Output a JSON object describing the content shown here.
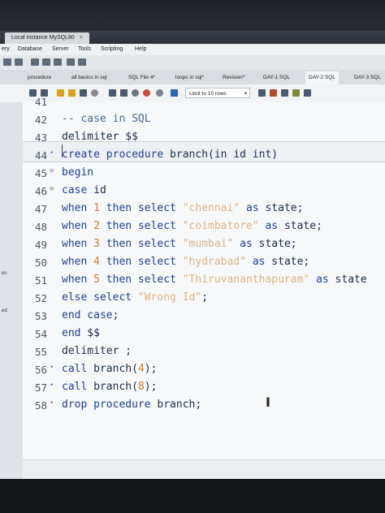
{
  "window": {
    "tab_title": "Local instance MySQL80",
    "tab_close": "×"
  },
  "menu": [
    "ery",
    "Database",
    "Server",
    "Tools",
    "Scripting",
    "Help"
  ],
  "file_tabs": [
    "procedure",
    "all basics in sql",
    "SQL File 4*",
    "loops in sql*",
    "Revision*",
    "DAY-1 SQL",
    "DAY-2 SQL",
    "DAY-3 SQL"
  ],
  "editor_toolbar": {
    "limit_label": "Limit to 10 rows",
    "limit_arrow": "▾"
  },
  "left_strip": [
    "es",
    "ed"
  ],
  "editor": {
    "lines": [
      {
        "num": "41",
        "fold": "",
        "tokens": []
      },
      {
        "num": "42",
        "fold": "",
        "tokens": [
          {
            "t": "cmt",
            "v": "-- case in SQL"
          }
        ]
      },
      {
        "num": "43",
        "fold": "",
        "tokens": [
          {
            "t": "txt",
            "v": "delimiter $$"
          }
        ]
      },
      {
        "num": "44",
        "fold": "•",
        "tokens": [
          {
            "t": "kw",
            "v": "create procedure"
          },
          {
            "t": "txt",
            "v": " branch(in id int)"
          }
        ]
      },
      {
        "num": "45",
        "fold": "⊖",
        "tokens": [
          {
            "t": "kw",
            "v": "begin"
          }
        ]
      },
      {
        "num": "46",
        "fold": "⊖",
        "tokens": [
          {
            "t": "kw",
            "v": "case"
          },
          {
            "t": "txt",
            "v": " id"
          }
        ]
      },
      {
        "num": "47",
        "fold": "",
        "tokens": [
          {
            "t": "kw",
            "v": "when"
          },
          {
            "t": "num",
            "v": " 1 "
          },
          {
            "t": "kw",
            "v": "then select"
          },
          {
            "t": "str",
            "v": " \"chennai\" "
          },
          {
            "t": "kw",
            "v": "as"
          },
          {
            "t": "txt",
            "v": " state;"
          }
        ]
      },
      {
        "num": "48",
        "fold": "",
        "tokens": [
          {
            "t": "kw",
            "v": "when"
          },
          {
            "t": "num",
            "v": " 2 "
          },
          {
            "t": "kw",
            "v": "then select"
          },
          {
            "t": "str",
            "v": " \"coimbatore\" "
          },
          {
            "t": "kw",
            "v": "as"
          },
          {
            "t": "txt",
            "v": " state;"
          }
        ]
      },
      {
        "num": "49",
        "fold": "",
        "tokens": [
          {
            "t": "kw",
            "v": "when"
          },
          {
            "t": "num",
            "v": " 3 "
          },
          {
            "t": "kw",
            "v": "then select"
          },
          {
            "t": "str",
            "v": " \"mumbai\" "
          },
          {
            "t": "kw",
            "v": "as"
          },
          {
            "t": "txt",
            "v": " state;"
          }
        ]
      },
      {
        "num": "50",
        "fold": "",
        "tokens": [
          {
            "t": "kw",
            "v": "when"
          },
          {
            "t": "num",
            "v": " 4 "
          },
          {
            "t": "kw",
            "v": "then select"
          },
          {
            "t": "str",
            "v": " \"hydrabad\" "
          },
          {
            "t": "kw",
            "v": "as"
          },
          {
            "t": "txt",
            "v": " state;"
          }
        ]
      },
      {
        "num": "51",
        "fold": "",
        "tokens": [
          {
            "t": "kw",
            "v": "when"
          },
          {
            "t": "num",
            "v": " 5 "
          },
          {
            "t": "kw",
            "v": "then select"
          },
          {
            "t": "str",
            "v": " \"Thiruvananthapuram\" "
          },
          {
            "t": "kw",
            "v": "as"
          },
          {
            "t": "txt",
            "v": " state"
          }
        ]
      },
      {
        "num": "52",
        "fold": "",
        "tokens": [
          {
            "t": "kw",
            "v": "else select"
          },
          {
            "t": "str",
            "v": " \"Wrong Id\""
          },
          {
            "t": "txt",
            "v": ";"
          }
        ]
      },
      {
        "num": "53",
        "fold": "",
        "tokens": [
          {
            "t": "kw",
            "v": "end case"
          },
          {
            "t": "txt",
            "v": ";"
          }
        ]
      },
      {
        "num": "54",
        "fold": "",
        "tokens": [
          {
            "t": "kw",
            "v": "end"
          },
          {
            "t": "txt",
            "v": " $$"
          }
        ]
      },
      {
        "num": "55",
        "fold": "",
        "tokens": [
          {
            "t": "txt",
            "v": "delimiter ;"
          }
        ]
      },
      {
        "num": "56",
        "fold": "•",
        "tokens": [
          {
            "t": "kw",
            "v": "call"
          },
          {
            "t": "txt",
            "v": " branch("
          },
          {
            "t": "num",
            "v": "4"
          },
          {
            "t": "txt",
            "v": ");"
          }
        ]
      },
      {
        "num": "57",
        "fold": "•",
        "tokens": [
          {
            "t": "kw",
            "v": "call"
          },
          {
            "t": "txt",
            "v": " branch("
          },
          {
            "t": "num",
            "v": "8"
          },
          {
            "t": "txt",
            "v": ");"
          }
        ]
      },
      {
        "num": "58",
        "fold": "•",
        "tokens": [
          {
            "t": "kw",
            "v": "drop procedure"
          },
          {
            "t": "txt",
            "v": " branch;"
          }
        ]
      }
    ]
  },
  "colors": {
    "keyword": "#1f3f8f",
    "number": "#cf7f2a",
    "string": "#d8b489",
    "comment": "#4b6a8e"
  }
}
